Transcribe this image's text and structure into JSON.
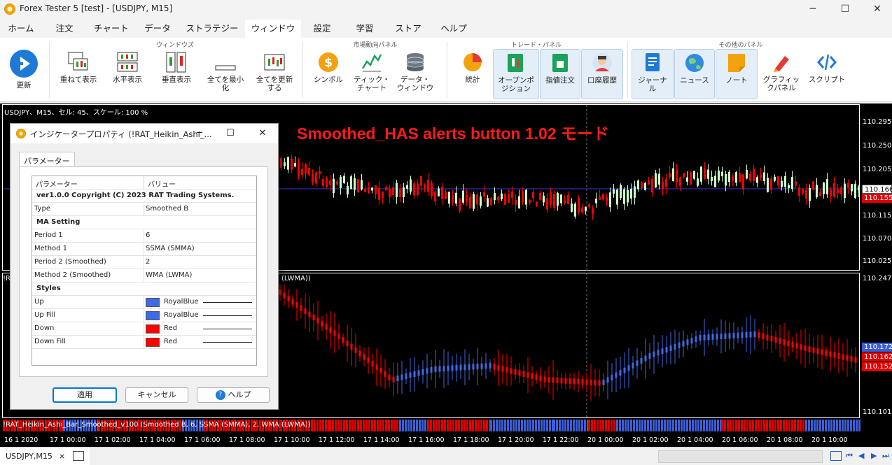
{
  "window": {
    "title": "Forex Tester 5  [test] - [USDJPY, M15]",
    "controls": [
      "─",
      "☐",
      "✕"
    ]
  },
  "menu": {
    "tabs": [
      "ホーム",
      "注文",
      "チャート",
      "データ",
      "ストラテジー",
      "ウィンドウ",
      "設定",
      "学習",
      "ストア",
      "ヘルプ"
    ],
    "active": "ウィンドウ"
  },
  "ribbon": {
    "groups": {
      "windows": "ウィンドウズ",
      "market": "市場動向パネル",
      "trade": "トレード・パネル",
      "other": "その他のパネル"
    },
    "buttons": {
      "refresh": "更新",
      "cascade": "重ねて表示",
      "tile_horizontal": "水平表示",
      "tile_vertical": "垂直表示",
      "minimize_all": "全てを最小\n化",
      "update_all": "全てを更新\nする",
      "symbol": "シンボル",
      "tick_chart": "ティック・\nチャート",
      "data_window": "データ・\nウィンドウ",
      "stats": "統計",
      "open_positions": "オープンポ\nジション",
      "pending_orders": "指値注文",
      "account_history": "口座履歴",
      "journal": "ジャーナ\nル",
      "news": "ニュース",
      "notes": "ノート",
      "graphics_panel": "グラフィッ\nクパネル",
      "script": "スクリプト"
    }
  },
  "chart": {
    "info": "USDJPY、M15、セル: 45、スケール: 100 %",
    "overlay_text": "Smoothed_HAS alerts button 1.02 モード",
    "sub_label_left": "!R",
    "sub_label_right": "(LWMA))",
    "strip_label": "!RAT_Heikin_Ashi_Bar_Smoothed_v100 (Smoothed B, 6, SSMA (SMMA), 2, WMA (LWMA))",
    "price_ticks": {
      "p1": "110.295",
      "p2": "110.250",
      "p3": "110.205",
      "p4": "110.115",
      "p5": "110.070",
      "p6": "110.025",
      "p7": "110.247",
      "p8": "110.101"
    },
    "price_boxes": {
      "main_current": "110.166",
      "main_red": "110.155",
      "sub_blue": "110.172",
      "sub_red_1": "110.162",
      "sub_red_2": "110.152"
    },
    "time_ticks": [
      "16 1 2020",
      "17 1 00:00",
      "17 1 02:00",
      "17 1 04:00",
      "17 1 06:00",
      "17 1 08:00",
      "17 1 10:00",
      "17 1 12:00",
      "17 1 14:00",
      "17 1 16:00",
      "17 1 18:00",
      "17 1 20:00",
      "17 1 22:00",
      "20 1 00:00",
      "20 1 02:00",
      "20 1 04:00",
      "20 1 06:00",
      "20 1 08:00",
      "20 1 10:00"
    ],
    "colors": {
      "background": "#000000",
      "bull": "#ccffcc",
      "bear": "#ff0000",
      "up": "#4169e1",
      "down": "#ff0000",
      "price_line": "#4040ff"
    }
  },
  "status": {
    "symbol_tab": "USDJPY,M15",
    "close": "×",
    "nav": [
      "⏮",
      "◀",
      "▶",
      "⏭"
    ]
  },
  "dialog": {
    "title": "インジケータープロパティ (!RAT_Heikin_Ashi_...",
    "controls": [
      "─",
      "☐",
      "✕"
    ],
    "tab": "パラメーター",
    "grid_headers": {
      "param": "パラメーター",
      "value": "バリュー"
    },
    "rows": [
      {
        "kind": "section",
        "label": "ver1.0.0 Copyright (C) 2023 RAT Trading Systems."
      },
      {
        "kind": "value",
        "label": "Type",
        "value": "Smoothed B"
      },
      {
        "kind": "section",
        "label": "MA Setting"
      },
      {
        "kind": "value",
        "label": "Period 1",
        "value": "6"
      },
      {
        "kind": "value",
        "label": "Method 1",
        "value": "SSMA (SMMA)"
      },
      {
        "kind": "value",
        "label": "Period 2 (Smoothed)",
        "value": "2"
      },
      {
        "kind": "value",
        "label": "Method 2 (Smoothed)",
        "value": "WMA (LWMA)"
      },
      {
        "kind": "section",
        "label": "Styles"
      },
      {
        "kind": "color",
        "label": "Up",
        "value": "RoyalBlue",
        "color": "#4169e1"
      },
      {
        "kind": "color",
        "label": "Up Fill",
        "value": "RoyalBlue",
        "color": "#4169e1"
      },
      {
        "kind": "color",
        "label": "Down",
        "value": "Red",
        "color": "#ff0000"
      },
      {
        "kind": "color",
        "label": "Down Fill",
        "value": "Red",
        "color": "#ff0000"
      }
    ],
    "buttons": {
      "apply": "適用",
      "cancel": "キャンセル",
      "help": "ヘルプ"
    }
  }
}
